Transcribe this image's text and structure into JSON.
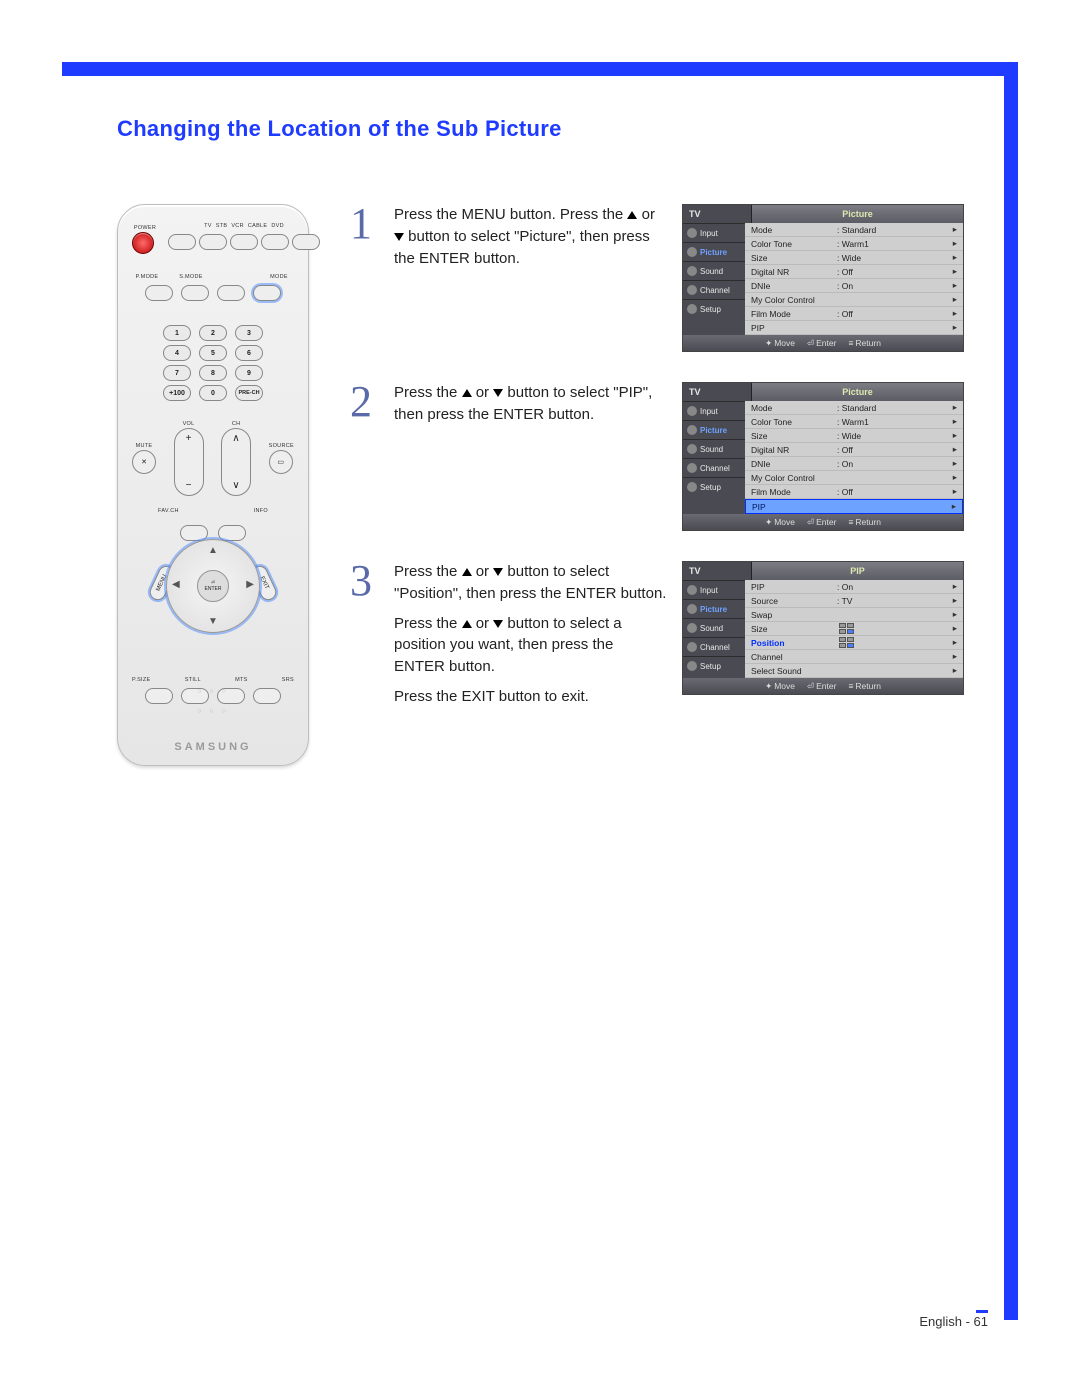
{
  "title": "Changing the Location of the Sub Picture",
  "footer": "English - 61",
  "remote": {
    "power": "POWER",
    "source_row": [
      "TV",
      "STB",
      "VCR",
      "CABLE",
      "DVD"
    ],
    "mode_row": {
      "labels": [
        "P.MODE",
        "S.MODE",
        "",
        ""
      ],
      "right": "MODE"
    },
    "numpad": [
      [
        "1",
        "2",
        "3"
      ],
      [
        "4",
        "5",
        "6"
      ],
      [
        "7",
        "8",
        "9"
      ],
      [
        "+100",
        "0",
        "PRE-CH"
      ]
    ],
    "vol_label": "VOL",
    "ch_label": "CH",
    "mute": "MUTE",
    "source": "SOURCE",
    "favch": "FAV.CH",
    "info": "INFO",
    "menu": "MENU",
    "exit": "EXIT",
    "enter": "ENTER",
    "bottom_row": [
      "P.SIZE",
      "STILL",
      "MTS",
      "SRS"
    ],
    "brand": "SAMSUNG"
  },
  "steps": [
    {
      "num": "1",
      "text": "Press the MENU button. Press the ▲ or ▼ button to select \"Picture\", then press the ENTER button.",
      "osd": {
        "tv": "TV",
        "header": "Picture",
        "tabs": [
          "Input",
          "Picture",
          "Sound",
          "Channel",
          "Setup"
        ],
        "activeTab": 1,
        "rows": [
          {
            "k": "Mode",
            "v": ": Standard"
          },
          {
            "k": "Color Tone",
            "v": ": Warm1"
          },
          {
            "k": "Size",
            "v": ": Wide"
          },
          {
            "k": "Digital NR",
            "v": ": Off"
          },
          {
            "k": "DNIe",
            "v": ": On"
          },
          {
            "k": "My Color Control",
            "v": ""
          },
          {
            "k": "Film Mode",
            "v": ": Off"
          },
          {
            "k": "PIP",
            "v": ""
          }
        ],
        "footer": [
          "Move",
          "Enter",
          "Return"
        ]
      }
    },
    {
      "num": "2",
      "text": "Press the ▲ or ▼ button to select \"PIP\", then press the ENTER button.",
      "osd": {
        "tv": "TV",
        "header": "Picture",
        "tabs": [
          "Input",
          "Picture",
          "Sound",
          "Channel",
          "Setup"
        ],
        "activeTab": 1,
        "rows": [
          {
            "k": "Mode",
            "v": ": Standard"
          },
          {
            "k": "Color Tone",
            "v": ": Warm1"
          },
          {
            "k": "Size",
            "v": ": Wide"
          },
          {
            "k": "Digital NR",
            "v": ": Off"
          },
          {
            "k": "DNIe",
            "v": ": On"
          },
          {
            "k": "My Color Control",
            "v": ""
          },
          {
            "k": "Film Mode",
            "v": ": Off"
          },
          {
            "k": "PIP",
            "v": "",
            "sel": true
          }
        ],
        "footer": [
          "Move",
          "Enter",
          "Return"
        ]
      }
    },
    {
      "num": "3",
      "text_parts": [
        "Press the ▲ or ▼ button to select \"Position\", then press the ENTER button.",
        "Press the ▲ or ▼ button to select a position you want, then press the ENTER button.",
        "Press the EXIT button to exit."
      ],
      "osd": {
        "tv": "TV",
        "header": "PIP",
        "tabs": [
          "Input",
          "Picture",
          "Sound",
          "Channel",
          "Setup"
        ],
        "activeTab": 1,
        "rows": [
          {
            "k": "PIP",
            "v": ": On"
          },
          {
            "k": "Source",
            "v": ": TV"
          },
          {
            "k": "Swap",
            "v": ""
          },
          {
            "k": "Size",
            "v": "",
            "quad": [
              0,
              0,
              0,
              1
            ]
          },
          {
            "k": "Position",
            "v": "",
            "quad": [
              0,
              0,
              0,
              1
            ],
            "hl": true
          },
          {
            "k": "Channel",
            "v": ""
          },
          {
            "k": "Select Sound",
            "v": ""
          }
        ],
        "footer": [
          "Move",
          "Enter",
          "Return"
        ]
      }
    }
  ]
}
